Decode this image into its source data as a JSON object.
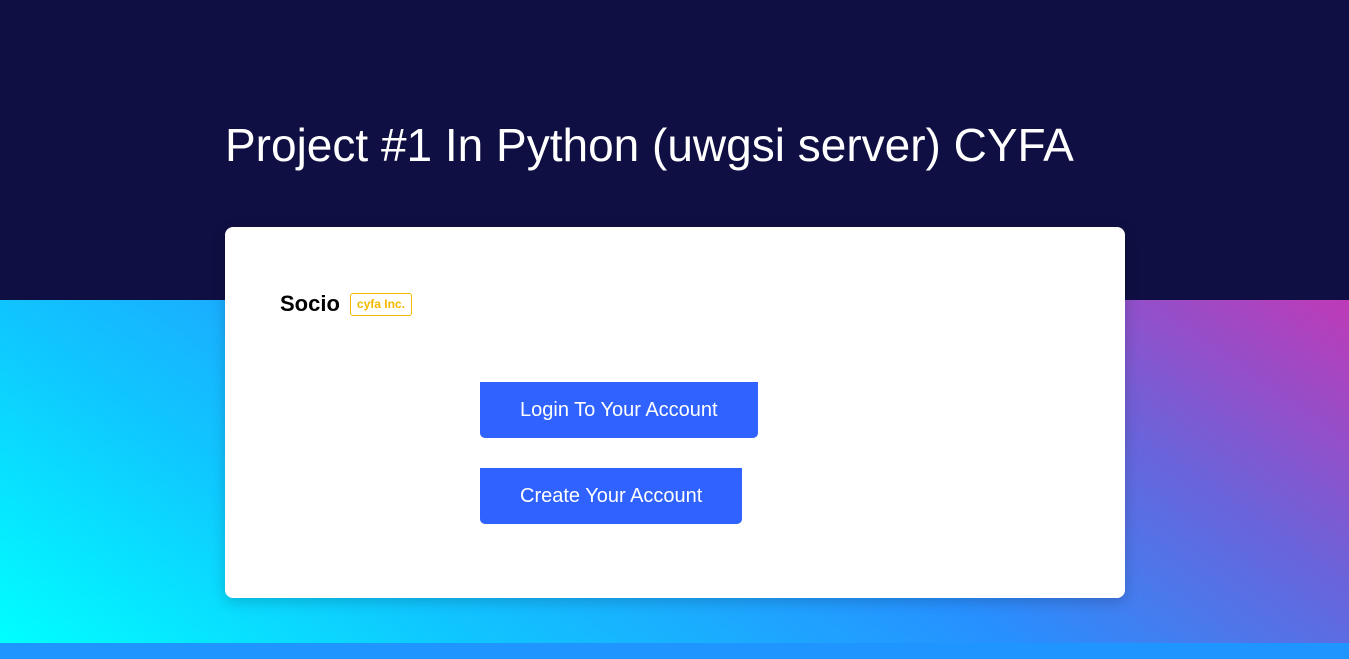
{
  "header": {
    "title": "Project #1 In Python (uwgsi server) CYFA"
  },
  "card": {
    "brand_name": "Socio",
    "brand_badge": "cyfa Inc.",
    "login_label": "Login To Your Account",
    "create_label": "Create Your Account"
  },
  "colors": {
    "header_background": "#0f0f43",
    "button_background": "#2f62ff",
    "badge_accent": "#f5b800",
    "gradient_start": "#00ffff",
    "gradient_end": "#bf3ab7"
  }
}
